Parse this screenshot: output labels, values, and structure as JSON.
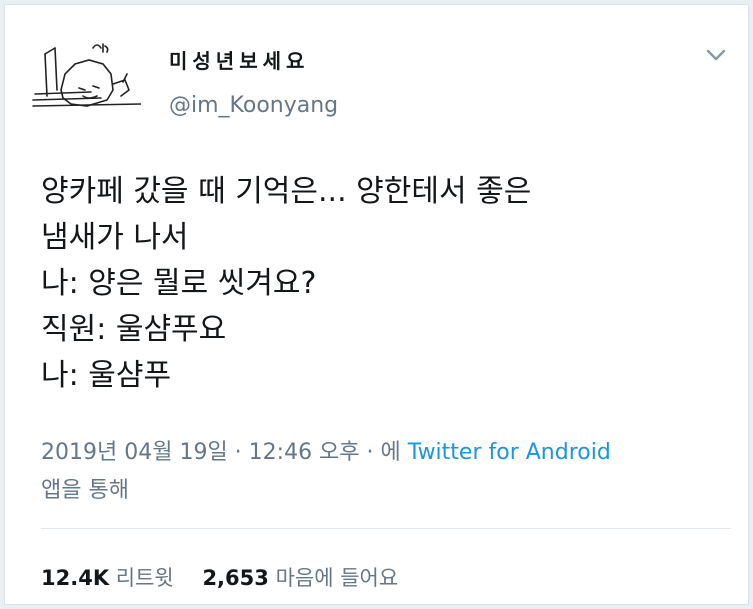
{
  "tweet": {
    "display_name": "미성년보세요",
    "handle": "@im_Koonyang",
    "lines": [
      "양카페 갔을 때 기억은... 양한테서 좋은",
      "냄새가 나서",
      "나: 양은 뭘로 씻겨요?",
      "직원: 울샴푸요",
      "나: 울샴푸"
    ],
    "timestamp": "2019년 04월 19일 · 12:46 오후 · 에",
    "source": "Twitter for Android",
    "source_suffix": "앱을 통해",
    "retweets_count": "12.4K",
    "retweets_label": "리트윗",
    "likes_count": "2,653",
    "likes_label": "마음에 들어요"
  },
  "icons": {
    "avatar": "cat-drawing-avatar",
    "menu": "chevron-down-icon"
  },
  "colors": {
    "text": "#14171a",
    "muted": "#657786",
    "link": "#1b95e0"
  }
}
